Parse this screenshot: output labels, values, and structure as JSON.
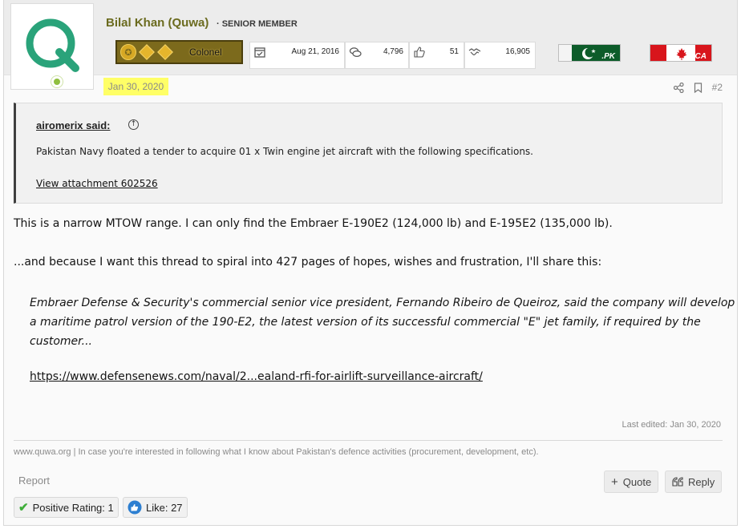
{
  "user": {
    "avatar_letter": "Q",
    "avatar_color": "#2aa37a",
    "name": "Bilal Khan (Quwa)",
    "title": "· SENIOR MEMBER",
    "rank": "Colonel",
    "online": true
  },
  "stats": {
    "joined": "Aug 21, 2016",
    "messages": "4,796",
    "reactions": "51",
    "points": "16,905"
  },
  "flags": [
    {
      "country": "Pakistan",
      "tld": ".PK"
    },
    {
      "country": "Canada",
      "tld": ".CA"
    }
  ],
  "post": {
    "date": "Jan 30, 2020",
    "number": "#2",
    "quote": {
      "author": "airomerix said:",
      "text": "Pakistan Navy floated a tender to acquire 01 x Twin engine jet aircraft with the following specifications.",
      "attachment": "View attachment 602526"
    },
    "paragraph1": "This is a narrow MTOW range. I can only find the Embraer E-190E2 (124,000 lb) and E-195E2 (135,000 lb).",
    "paragraph2": "...and because I want this thread to spiral into 427 pages of hopes, wishes and frustration, I'll share this:",
    "italic_quote": "Embraer Defense & Security's commercial senior vice president, Fernando Ribeiro de Queiroz, said the company will develop a maritime patrol version of the 190-E2, the latest version of its successful commercial \"E\" jet family, if required by the customer...",
    "link": "https://www.defensenews.com/naval/2...ealand-rfi-for-airlift-surveillance-aircraft/",
    "last_edited": "Last edited: Jan 30, 2020",
    "signature": "www.quwa.org | In case you're interested in following what I know about Pakistan's defence activities (procurement, development, etc)."
  },
  "actions": {
    "report": "Report",
    "quote": "Quote",
    "reply": "Reply"
  },
  "reactions": [
    {
      "label": "Positive Rating: 1"
    },
    {
      "label": "Like: 27"
    }
  ],
  "colors": {
    "highlight": "#ffff66",
    "username": "#6b6b1f",
    "like_blue": "#2d7fd1",
    "positive_green": "#3fae3a"
  }
}
